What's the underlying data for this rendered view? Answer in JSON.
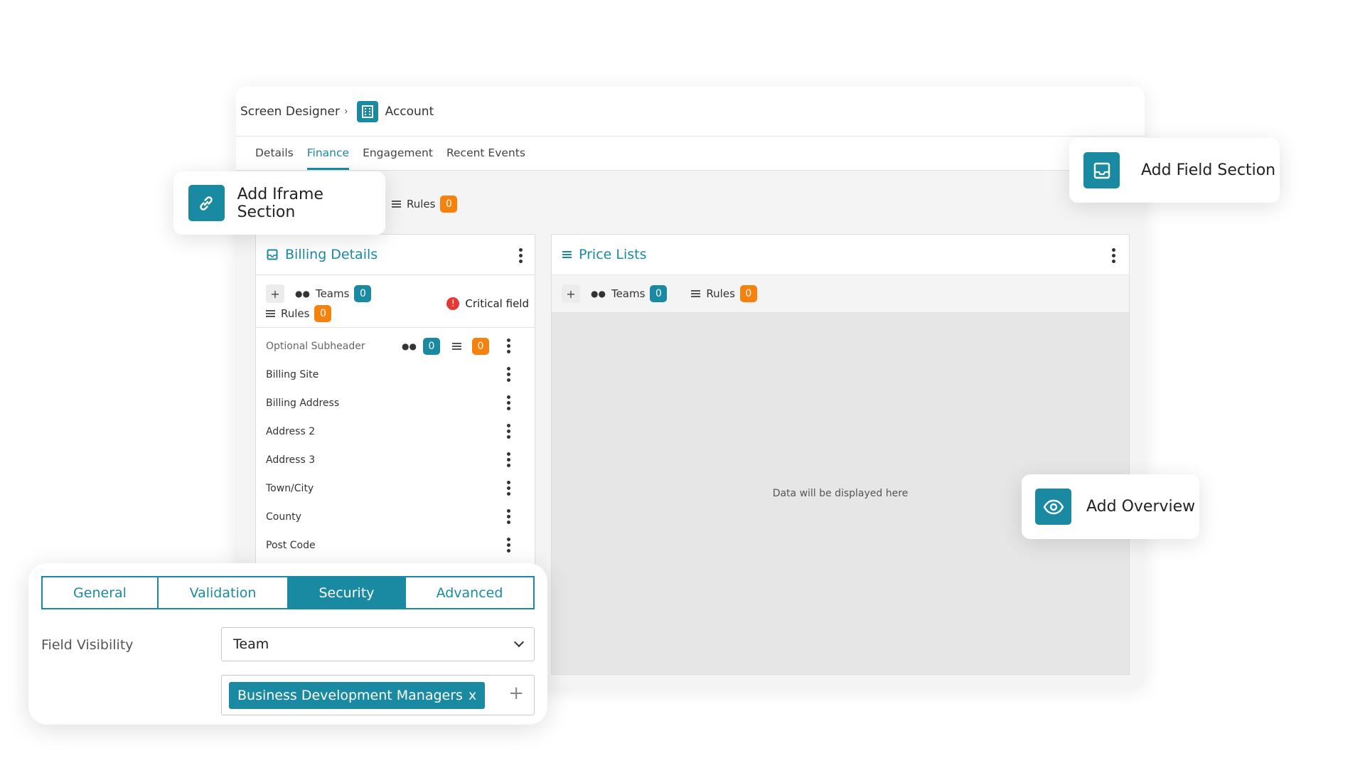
{
  "breadcrumb": {
    "root": "Screen Designer",
    "separator": "›",
    "entity": "Account"
  },
  "tabs": [
    "Details",
    "Finance",
    "Engagement",
    "Recent Events"
  ],
  "active_tab": "Finance",
  "rules_bar": {
    "label": "Rules",
    "count": "0"
  },
  "billing": {
    "title": "Billing Details",
    "teams_label": "Teams",
    "teams_count": "0",
    "rules_label": "Rules",
    "rules_count": "0",
    "critical_label": "Critical field",
    "subheader": {
      "label": "Optional Subheader",
      "teams_count": "0",
      "rules_count": "0"
    },
    "fields": [
      "Billing Site",
      "Billing Address",
      "Address 2",
      "Address 3",
      "Town/City",
      "County",
      "Post Code"
    ]
  },
  "price_lists": {
    "title": "Price Lists",
    "teams_label": "Teams",
    "teams_count": "0",
    "rules_label": "Rules",
    "rules_count": "0",
    "placeholder": "Data will be displayed here"
  },
  "floating": {
    "iframe": "Add Iframe Section",
    "field_section": "Add Field Section",
    "overview": "Add Overview"
  },
  "settings": {
    "tabs": [
      "General",
      "Validation",
      "Security",
      "Advanced"
    ],
    "active": "Security",
    "field_visibility_label": "Field Visibility",
    "visibility_value": "Team",
    "tag": "Business Development Managers",
    "tag_remove": "x",
    "add": "+"
  },
  "colors": {
    "accent": "#1a8aa3",
    "badge_orange": "#f5820d",
    "critical": "#e53935"
  }
}
